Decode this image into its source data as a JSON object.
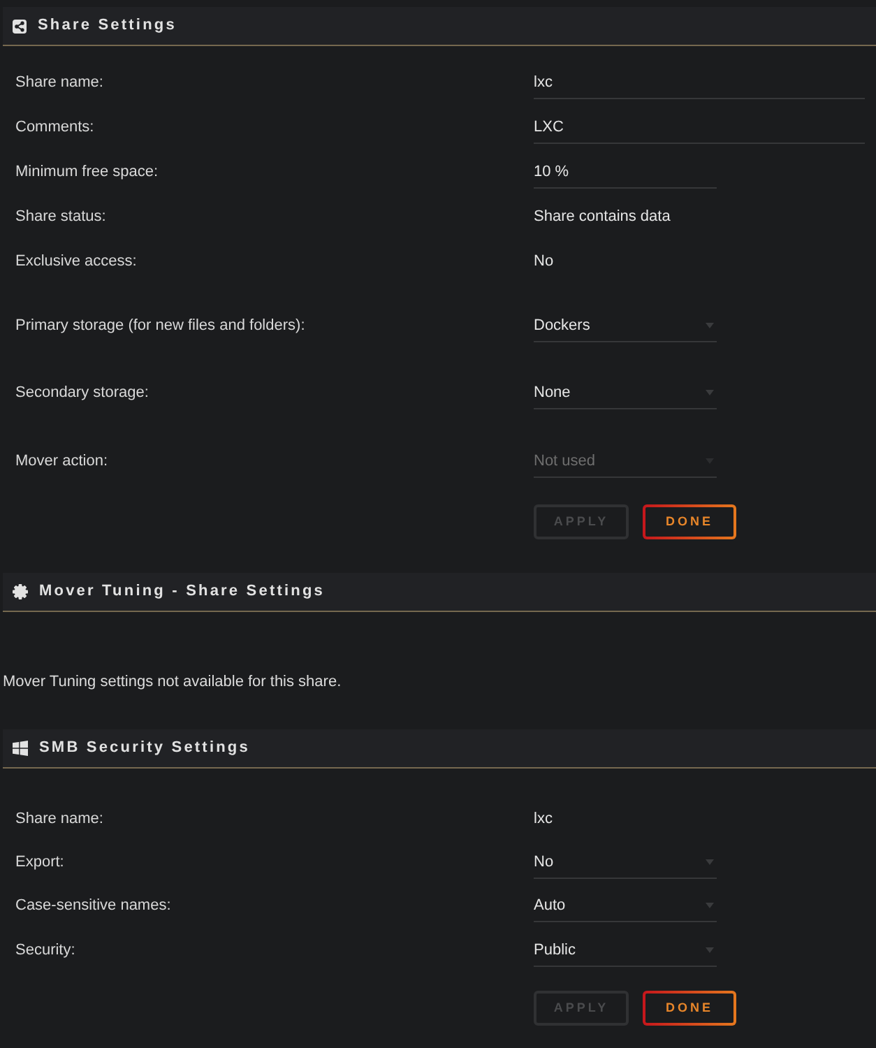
{
  "sections": [
    {
      "title": "Share Settings",
      "kind": "form",
      "fields": [
        {
          "label": "Share name:",
          "kind": "input",
          "value": "lxc",
          "disabled": false
        },
        {
          "label": "Comments:",
          "kind": "input",
          "value": "LXC",
          "disabled": false
        },
        {
          "label": "Minimum free space:",
          "kind": "shortinput",
          "value": "10 %",
          "disabled": false
        },
        {
          "label": "Share status:",
          "kind": "text",
          "value": "Share contains data",
          "disabled": false
        },
        {
          "label": "Exclusive access:",
          "kind": "text",
          "value": "No",
          "disabled": false
        },
        {
          "label": "Primary storage (for new files and folders):",
          "kind": "select",
          "value": "Dockers",
          "disabled": false
        },
        {
          "label": "Secondary storage:",
          "kind": "select",
          "value": "None",
          "disabled": false
        },
        {
          "label": "Mover action:",
          "kind": "select",
          "value": "Not used",
          "disabled": true
        }
      ],
      "buttons": [
        {
          "label": "APPLY",
          "disabled": true
        },
        {
          "label": "DONE",
          "disabled": false
        }
      ]
    },
    {
      "title": "Mover Tuning - Share Settings",
      "kind": "message",
      "message": "Mover Tuning settings not available for this share."
    },
    {
      "title": "SMB Security Settings",
      "kind": "form",
      "fields": [
        {
          "label": "Share name:",
          "kind": "text",
          "value": "lxc",
          "disabled": false
        },
        {
          "label": "Export:",
          "kind": "select",
          "value": "No",
          "disabled": false
        },
        {
          "label": "Case-sensitive names:",
          "kind": "select",
          "value": "Auto",
          "disabled": false
        },
        {
          "label": "Security:",
          "kind": "select",
          "value": "Public",
          "disabled": false
        }
      ],
      "buttons": [
        {
          "label": "APPLY",
          "disabled": true
        },
        {
          "label": "DONE",
          "disabled": false
        }
      ]
    }
  ]
}
